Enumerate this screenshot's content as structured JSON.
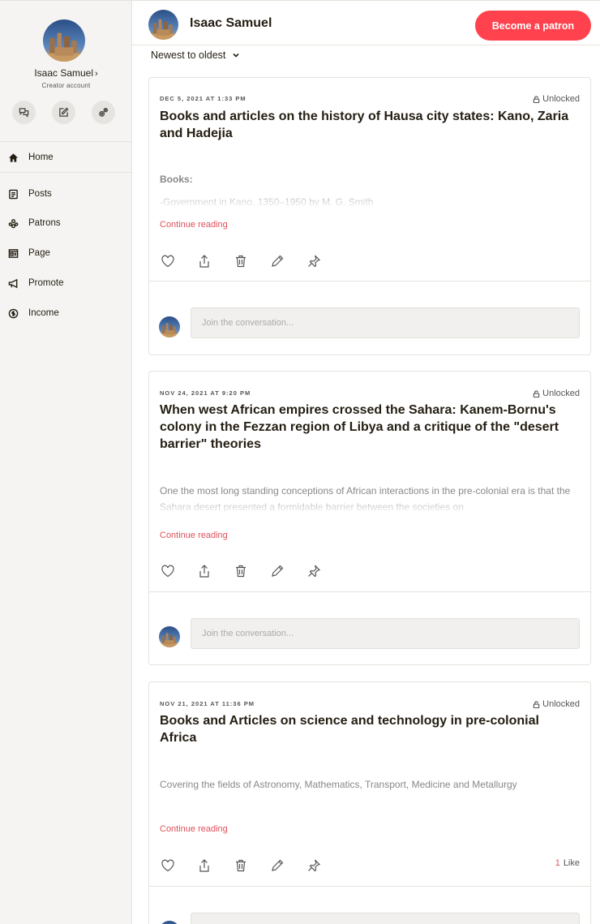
{
  "sidebar": {
    "creator_name": "Isaac Samuel",
    "creator_subtitle": "Creator account",
    "nav": [
      {
        "label": "Home",
        "icon": "home-icon"
      },
      {
        "label": "Posts",
        "icon": "posts-icon"
      },
      {
        "label": "Patrons",
        "icon": "patrons-icon"
      },
      {
        "label": "Page",
        "icon": "page-icon"
      },
      {
        "label": "Promote",
        "icon": "megaphone-icon"
      },
      {
        "label": "Income",
        "icon": "coin-icon"
      }
    ]
  },
  "header": {
    "name": "Isaac Samuel",
    "patron_button": "Become a patron"
  },
  "sort": {
    "label": "Newest to oldest"
  },
  "posts": [
    {
      "date": "DEC 5, 2021 AT 1:33 PM",
      "status": "Unlocked",
      "title": "Books and articles on the history of Hausa city states: Kano, Zaria and Hadejia",
      "excerpt_heading": "Books:",
      "excerpt": "-Government in Kano, 1350–1950 by M. G. Smith",
      "continue": "Continue reading",
      "comment_placeholder": "Join the conversation..."
    },
    {
      "date": "NOV 24, 2021 AT 9:20 PM",
      "status": "Unlocked",
      "title": "When west African empires crossed the Sahara: Kanem-Bornu's colony in the Fezzan region of Libya and a critique of the \"desert barrier\" theories",
      "excerpt": "One the most long standing conceptions of African interactions in the pre-colonial era is that the Sahara desert presented a formidable barrier between the societies on",
      "continue": "Continue reading",
      "comment_placeholder": "Join the conversation..."
    },
    {
      "date": "NOV 21, 2021 AT 11:36 PM",
      "status": "Unlocked",
      "title": "Books and Articles on science and technology in pre-colonial Africa",
      "excerpt": "Covering the fields of Astronomy, Mathematics, Transport, Medicine and Metallurgy",
      "continue": "Continue reading",
      "likes_count": "1",
      "likes_label": "Like"
    }
  ],
  "colors": {
    "brand": "#ff424d",
    "link": "#e0505a",
    "sidebar_bg": "#f5f4f2"
  }
}
